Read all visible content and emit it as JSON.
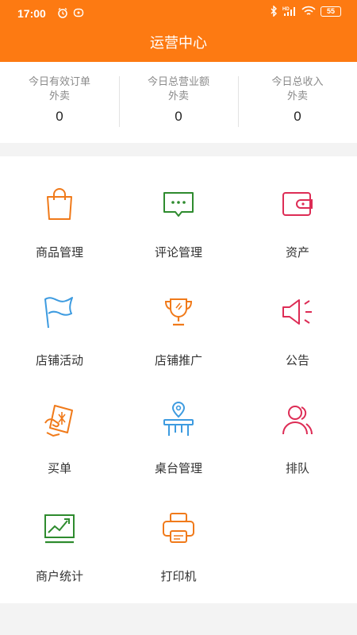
{
  "status_bar": {
    "time": "17:00",
    "battery": "55"
  },
  "header": {
    "title": "运营中心"
  },
  "stats": [
    {
      "label1": "今日有效订单",
      "label2": "外卖",
      "value": "0"
    },
    {
      "label1": "今日总营业额",
      "label2": "外卖",
      "value": "0"
    },
    {
      "label1": "今日总收入",
      "label2": "外卖",
      "value": "0"
    }
  ],
  "menu": [
    {
      "label": "商品管理",
      "icon": "shopping-bag-icon"
    },
    {
      "label": "评论管理",
      "icon": "comment-icon"
    },
    {
      "label": "资产",
      "icon": "wallet-icon"
    },
    {
      "label": "店铺活动",
      "icon": "flag-icon"
    },
    {
      "label": "店铺推广",
      "icon": "trophy-icon"
    },
    {
      "label": "公告",
      "icon": "megaphone-icon"
    },
    {
      "label": "买单",
      "icon": "bill-icon"
    },
    {
      "label": "桌台管理",
      "icon": "table-icon"
    },
    {
      "label": "排队",
      "icon": "queue-icon"
    },
    {
      "label": "商户统计",
      "icon": "chart-icon"
    },
    {
      "label": "打印机",
      "icon": "printer-icon"
    }
  ],
  "colors": {
    "header": "#fd7a12",
    "orange": "#f07a1a",
    "green": "#2e8b2e",
    "red": "#dd2c55",
    "blue": "#3d9be0"
  }
}
